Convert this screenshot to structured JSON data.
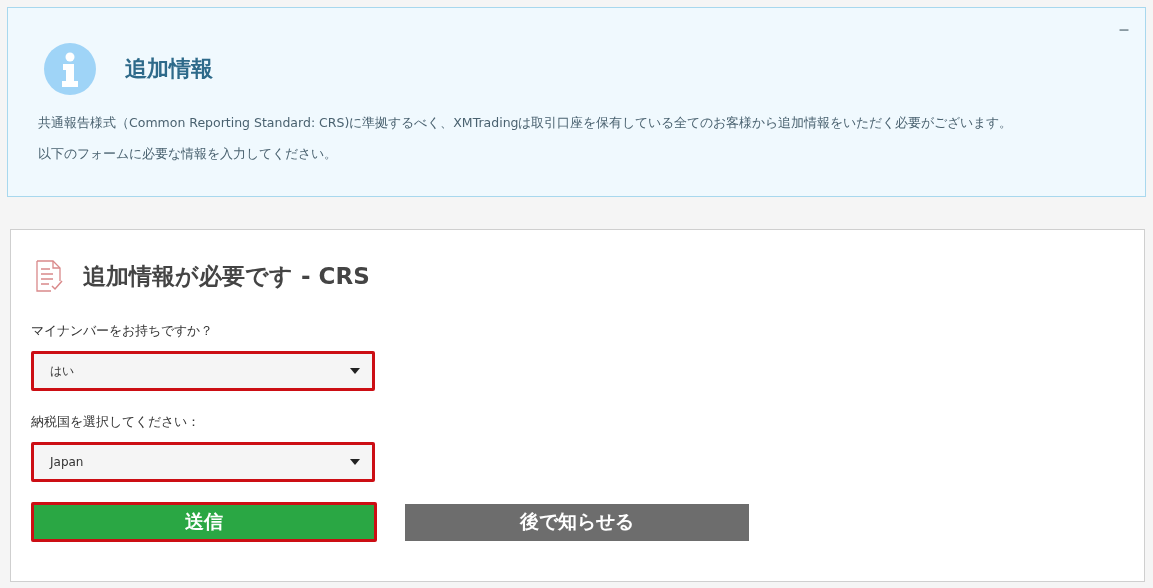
{
  "info_panel": {
    "title": "追加情報",
    "collapse": "–",
    "paragraphs": [
      "共通報告様式（Common Reporting Standard: CRS)に準拠するべく、XMTradingは取引口座を保有している全てのお客様から追加情報をいただく必要がございます。",
      "以下のフォームに必要な情報を入力してください。"
    ]
  },
  "form": {
    "title": "追加情報が必要です - CRS",
    "fields": [
      {
        "label": "マイナンバーをお持ちですか？",
        "value": "はい",
        "highlighted": true
      },
      {
        "label": "納税国を選択してください：",
        "value": "Japan",
        "highlighted": true
      }
    ],
    "buttons": [
      {
        "label": "送信",
        "kind": "primary",
        "highlighted": true
      },
      {
        "label": "後で知らせる",
        "kind": "secondary",
        "highlighted": false
      }
    ]
  }
}
